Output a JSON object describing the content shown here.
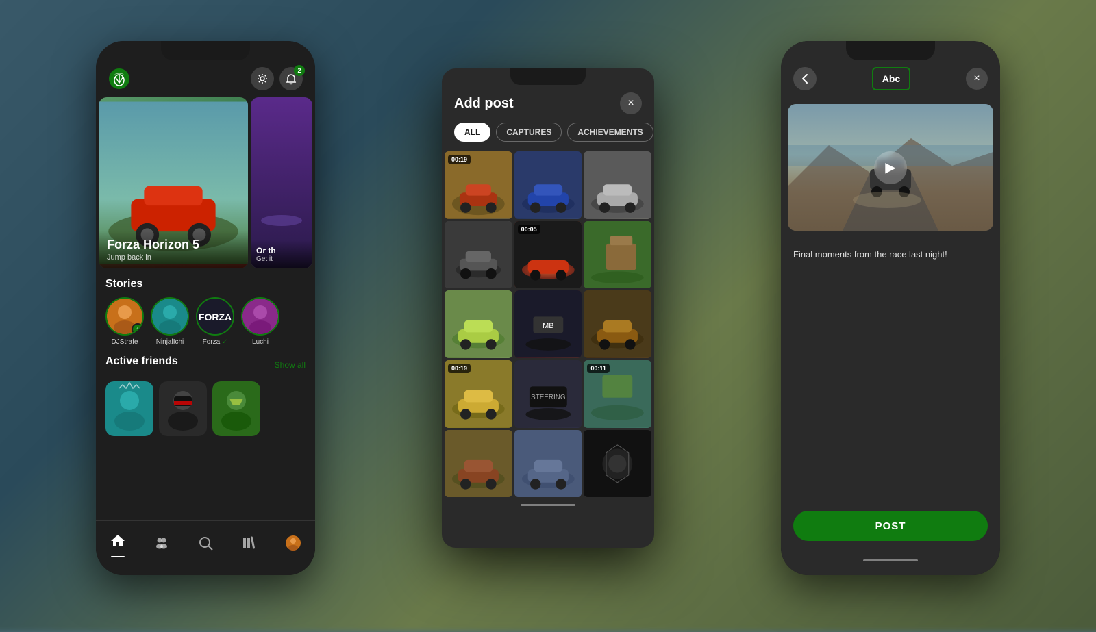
{
  "background": {
    "color": "#4a6a7a"
  },
  "left_phone": {
    "header": {
      "notification_count": "2"
    },
    "hero": {
      "main_title": "Forza Horizon 5",
      "main_subtitle": "Jump back in",
      "side_text": "Or th",
      "side_subtext": "Get it"
    },
    "stories": {
      "section_title": "Stories",
      "items": [
        {
          "name": "DJStrafe",
          "has_add": true,
          "verified": false,
          "color": "av-orange"
        },
        {
          "name": "NinjalIchi",
          "has_add": false,
          "verified": false,
          "color": "av-teal"
        },
        {
          "name": "Forza ✓",
          "has_add": false,
          "verified": true,
          "color": "av-forza"
        },
        {
          "name": "Luchi",
          "has_add": false,
          "verified": false,
          "color": "av-purple"
        }
      ]
    },
    "active_friends": {
      "section_title": "Active friends",
      "show_all_label": "Show all",
      "friends": [
        {
          "color": "av-teal"
        },
        {
          "color": "av-dark"
        },
        {
          "color": "av-multi"
        }
      ]
    },
    "bottom_nav": {
      "items": [
        {
          "icon": "⌂",
          "label": "home",
          "active": true
        },
        {
          "icon": "⚬⚬",
          "label": "community",
          "active": false
        },
        {
          "icon": "⌕",
          "label": "search",
          "active": false
        },
        {
          "icon": "▤",
          "label": "library",
          "active": false
        },
        {
          "icon": "◉",
          "label": "profile",
          "active": false
        }
      ]
    }
  },
  "center_modal": {
    "title": "Add post",
    "close_label": "×",
    "filters": [
      {
        "label": "ALL",
        "active": true
      },
      {
        "label": "CAPTURES",
        "active": false
      },
      {
        "label": "ACHIEVEMENTS",
        "active": false
      }
    ],
    "grid": [
      {
        "id": 1,
        "has_video": true,
        "duration": "00:19",
        "color": "car-1"
      },
      {
        "id": 2,
        "has_video": false,
        "duration": "",
        "color": "car-2"
      },
      {
        "id": 3,
        "has_video": false,
        "duration": "",
        "color": "car-3"
      },
      {
        "id": 4,
        "has_video": false,
        "duration": "",
        "color": "car-4"
      },
      {
        "id": 5,
        "has_video": true,
        "duration": "00:05",
        "color": "car-5"
      },
      {
        "id": 6,
        "has_video": false,
        "duration": "",
        "color": "car-6"
      },
      {
        "id": 7,
        "has_video": false,
        "duration": "",
        "color": "car-7"
      },
      {
        "id": 8,
        "has_video": false,
        "duration": "",
        "color": "car-8"
      },
      {
        "id": 9,
        "has_video": false,
        "duration": "",
        "color": "car-9"
      },
      {
        "id": 10,
        "has_video": true,
        "duration": "00:19",
        "color": "car-10"
      },
      {
        "id": 11,
        "has_video": false,
        "duration": "",
        "color": "car-11"
      },
      {
        "id": 12,
        "has_video": true,
        "duration": "00:11",
        "color": "car-12"
      },
      {
        "id": 13,
        "has_video": false,
        "duration": "",
        "color": "car-13"
      },
      {
        "id": 14,
        "has_video": false,
        "duration": "",
        "color": "car-14"
      },
      {
        "id": 15,
        "has_video": false,
        "duration": "",
        "color": "car-15"
      }
    ]
  },
  "right_phone": {
    "back_label": "‹",
    "abc_label": "Abc",
    "close_label": "×",
    "video_preview": {
      "play_icon": "▶"
    },
    "caption": "Final moments from the race last night!",
    "post_button_label": "POST"
  }
}
